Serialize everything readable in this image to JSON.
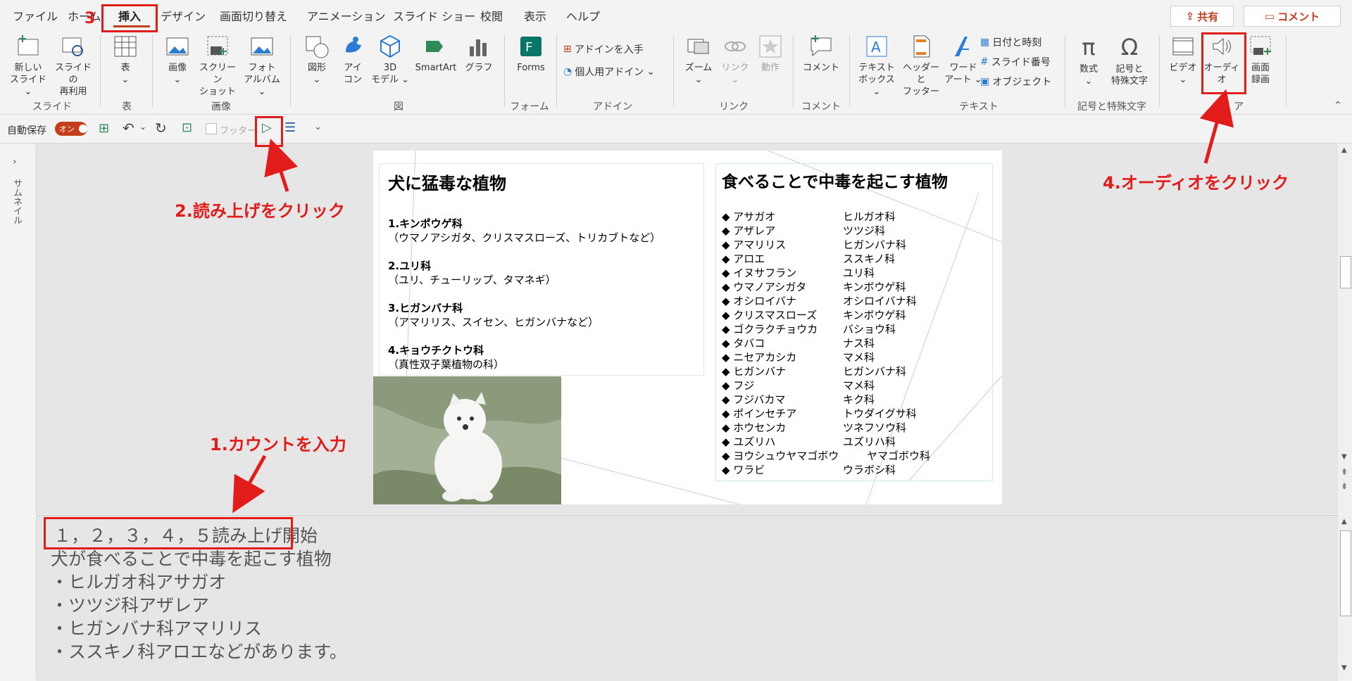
{
  "tabs": [
    "ファイル",
    "ホーム",
    "挿入",
    "デザイン",
    "画面切り替え",
    "アニメーション",
    "スライド ショー",
    "校閲",
    "表示",
    "ヘルプ"
  ],
  "share_label": "共有",
  "comment_label": "コメント",
  "ribbon": {
    "new_slide": [
      "新しい",
      "スライド"
    ],
    "reuse_slide": [
      "スライドの",
      "再利用"
    ],
    "table": "表",
    "image": "画像",
    "screenshot": [
      "スクリーン",
      "ショット"
    ],
    "photo_album": [
      "フォト",
      "アルバム"
    ],
    "shapes": "図形",
    "icons": [
      "アイ",
      "コン"
    ],
    "model3d": [
      "3D",
      "モデル"
    ],
    "smartart": "SmartArt",
    "chart": "グラフ",
    "forms": "Forms",
    "get_addins": "アドインを入手",
    "my_addins": "個人用アドイン",
    "zoom": "ズーム",
    "link": "リンク",
    "action": "動作",
    "comment": "コメント",
    "textbox": [
      "テキスト",
      "ボックス"
    ],
    "header_footer": [
      "ヘッダーと",
      "フッター"
    ],
    "wordart": [
      "ワード",
      "アート"
    ],
    "date_time": "日付と時刻",
    "slide_number": "スライド番号",
    "object": "オブジェクト",
    "equation": "数式",
    "symbol": [
      "記号と",
      "特殊文字"
    ],
    "video": "ビデオ",
    "audio": "オーディオ",
    "screen_record": [
      "画面",
      "録画"
    ]
  },
  "groups": [
    "スライド",
    "表",
    "画像",
    "図",
    "フォーム",
    "アドイン",
    "リンク",
    "コメント",
    "テキスト",
    "記号と特殊文字",
    "ア"
  ],
  "qat": {
    "autosave": "自動保存",
    "autosave_state": "オン",
    "footer": "フッター"
  },
  "thumbnail_label": "サムネイル",
  "slide": {
    "left_title": "犬に猛毒な植物",
    "left_items": [
      {
        "head": "1.キンポウゲ科",
        "detail": "（ウマノアシガタ、クリスマスローズ、トリカブトなど）"
      },
      {
        "head": "2.ユリ科",
        "detail": "（ユリ、チューリップ、タマネギ）"
      },
      {
        "head": "3.ヒガンバナ科",
        "detail": "（アマリリス、スイセン、ヒガンバナなど）"
      },
      {
        "head": "4.キョウチクトウ科",
        "detail": "（真性双子葉植物の科）"
      }
    ],
    "right_title": "食べることで中毒を起こす植物",
    "plants": [
      {
        "name": "◆ アサガオ",
        "family": "ヒルガオ科"
      },
      {
        "name": "◆ アザレア",
        "family": "ツツジ科"
      },
      {
        "name": "◆ アマリリス",
        "family": "ヒガンバナ科"
      },
      {
        "name": "◆ アロエ",
        "family": "ススキノ科"
      },
      {
        "name": "◆ イヌサフラン",
        "family": "ユリ科"
      },
      {
        "name": "◆ ウマノアシガタ",
        "family": "キンボウゲ科"
      },
      {
        "name": "◆ オシロイバナ",
        "family": "オシロイバナ科"
      },
      {
        "name": "◆ クリスマスローズ",
        "family": "キンボウゲ科"
      },
      {
        "name": "◆ ゴクラクチョウカ",
        "family": "バショウ科"
      },
      {
        "name": "◆ タバコ",
        "family": "ナス科"
      },
      {
        "name": "◆ ニセアカシカ",
        "family": "マメ科"
      },
      {
        "name": "◆ ヒガンバナ",
        "family": "ヒガンバナ科"
      },
      {
        "name": "◆ フジ",
        "family": "マメ科"
      },
      {
        "name": "◆ フジバカマ",
        "family": "キク科"
      },
      {
        "name": "◆ ポインセチア",
        "family": "トウダイグサ科"
      },
      {
        "name": "◆ ホウセンカ",
        "family": "ツネフソウ科"
      },
      {
        "name": "◆ ユズリハ",
        "family": "ユズリハ科"
      },
      {
        "name": "◆ ヨウシュウヤマゴボウ",
        "family": "ヤマゴボウ科"
      },
      {
        "name": "◆ ワラビ",
        "family": "ウラボシ科"
      }
    ]
  },
  "notes": [
    "１，２，３，４，５読み上げ開始",
    "犬が食べることで中毒を起こす植物",
    "・ヒルガオ科アサガオ",
    "・ツツジ科アザレア",
    "・ヒガンバナ科アマリリス",
    "・ススキノ科アロエなどがあります。"
  ],
  "annotations": {
    "step1": "1.カウントを入力",
    "step2": "2.読み上げをクリック",
    "step3": "3",
    "step4": "4.オーディオをクリック"
  },
  "colors": {
    "accent_red": "#e21b1b",
    "brand": "#c43e1c"
  }
}
